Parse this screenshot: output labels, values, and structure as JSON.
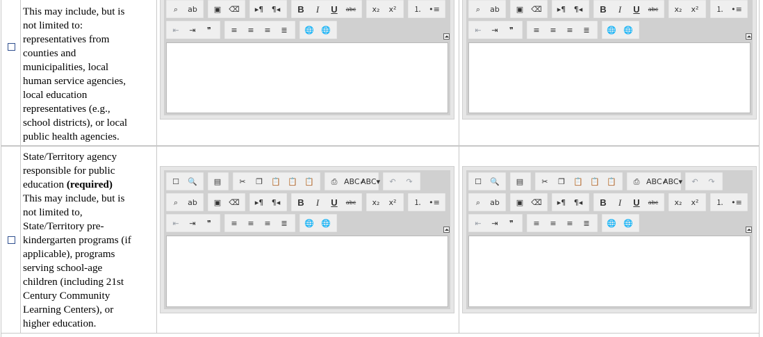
{
  "rows": [
    {
      "lines": [
        "This may include, but is",
        "not limited to:",
        "representatives from",
        "counties and",
        "municipalities, local",
        "human service agencies,",
        "local education",
        "representatives (e.g.,",
        "school districts), or local",
        "public health agencies."
      ]
    },
    {
      "lines": [
        "State/Territory agency",
        "responsible for public",
        "education",
        "(required)",
        "This may include, but is",
        "not limited to,",
        "State/Territory pre-",
        "kindergarten programs (if",
        "applicable), programs",
        "serving school-age",
        "children (including 21st",
        "Century Community",
        "Learning Centers), or",
        "higher education."
      ]
    }
  ],
  "editor": {
    "toolbar_row1": [
      {
        "icon": "new-page-icon",
        "glyph": "☐"
      },
      {
        "icon": "preview-icon",
        "glyph": "🔍"
      },
      {
        "icon": "templates-icon",
        "glyph": "▤"
      },
      {
        "icon": "cut-icon",
        "glyph": "✂"
      },
      {
        "icon": "copy-icon",
        "glyph": "❐"
      },
      {
        "icon": "paste-icon",
        "glyph": "📋"
      },
      {
        "icon": "paste-text-icon",
        "glyph": "📋"
      },
      {
        "icon": "paste-word-icon",
        "glyph": "📋"
      },
      {
        "icon": "print-icon",
        "glyph": "⎙"
      },
      {
        "icon": "spellcheck-icon",
        "glyph": "ABC✓"
      },
      {
        "icon": "spellcheck-dropdown-icon",
        "glyph": "ABC▾"
      },
      {
        "icon": "undo-icon",
        "glyph": "↶"
      },
      {
        "icon": "redo-icon",
        "glyph": "↷"
      }
    ],
    "toolbar_row2": [
      {
        "icon": "find-icon",
        "glyph": "⌕"
      },
      {
        "icon": "replace-icon",
        "glyph": "ab"
      },
      {
        "icon": "select-all-icon",
        "glyph": "▣"
      },
      {
        "icon": "remove-format-icon",
        "glyph": "⌫"
      },
      {
        "icon": "ltr-icon",
        "glyph": "▸¶"
      },
      {
        "icon": "rtl-icon",
        "glyph": "¶◂"
      },
      {
        "icon": "bold-icon",
        "glyph": "B"
      },
      {
        "icon": "italic-icon",
        "glyph": "I"
      },
      {
        "icon": "underline-icon",
        "glyph": "U"
      },
      {
        "icon": "strike-icon",
        "glyph": "abc"
      },
      {
        "icon": "subscript-icon",
        "glyph": "x₂"
      },
      {
        "icon": "superscript-icon",
        "glyph": "x²"
      },
      {
        "icon": "numbered-list-icon",
        "glyph": "⒈"
      },
      {
        "icon": "bulleted-list-icon",
        "glyph": "•≡"
      }
    ],
    "toolbar_row3": [
      {
        "icon": "outdent-icon",
        "glyph": "⇤"
      },
      {
        "icon": "indent-icon",
        "glyph": "⇥"
      },
      {
        "icon": "blockquote-icon",
        "glyph": "❞"
      },
      {
        "icon": "align-left-icon",
        "glyph": "≡"
      },
      {
        "icon": "align-center-icon",
        "glyph": "≡"
      },
      {
        "icon": "align-right-icon",
        "glyph": "≡"
      },
      {
        "icon": "justify-icon",
        "glyph": "≣"
      },
      {
        "icon": "link-icon",
        "glyph": "🌐"
      },
      {
        "icon": "unlink-icon",
        "glyph": "🌐"
      }
    ]
  }
}
